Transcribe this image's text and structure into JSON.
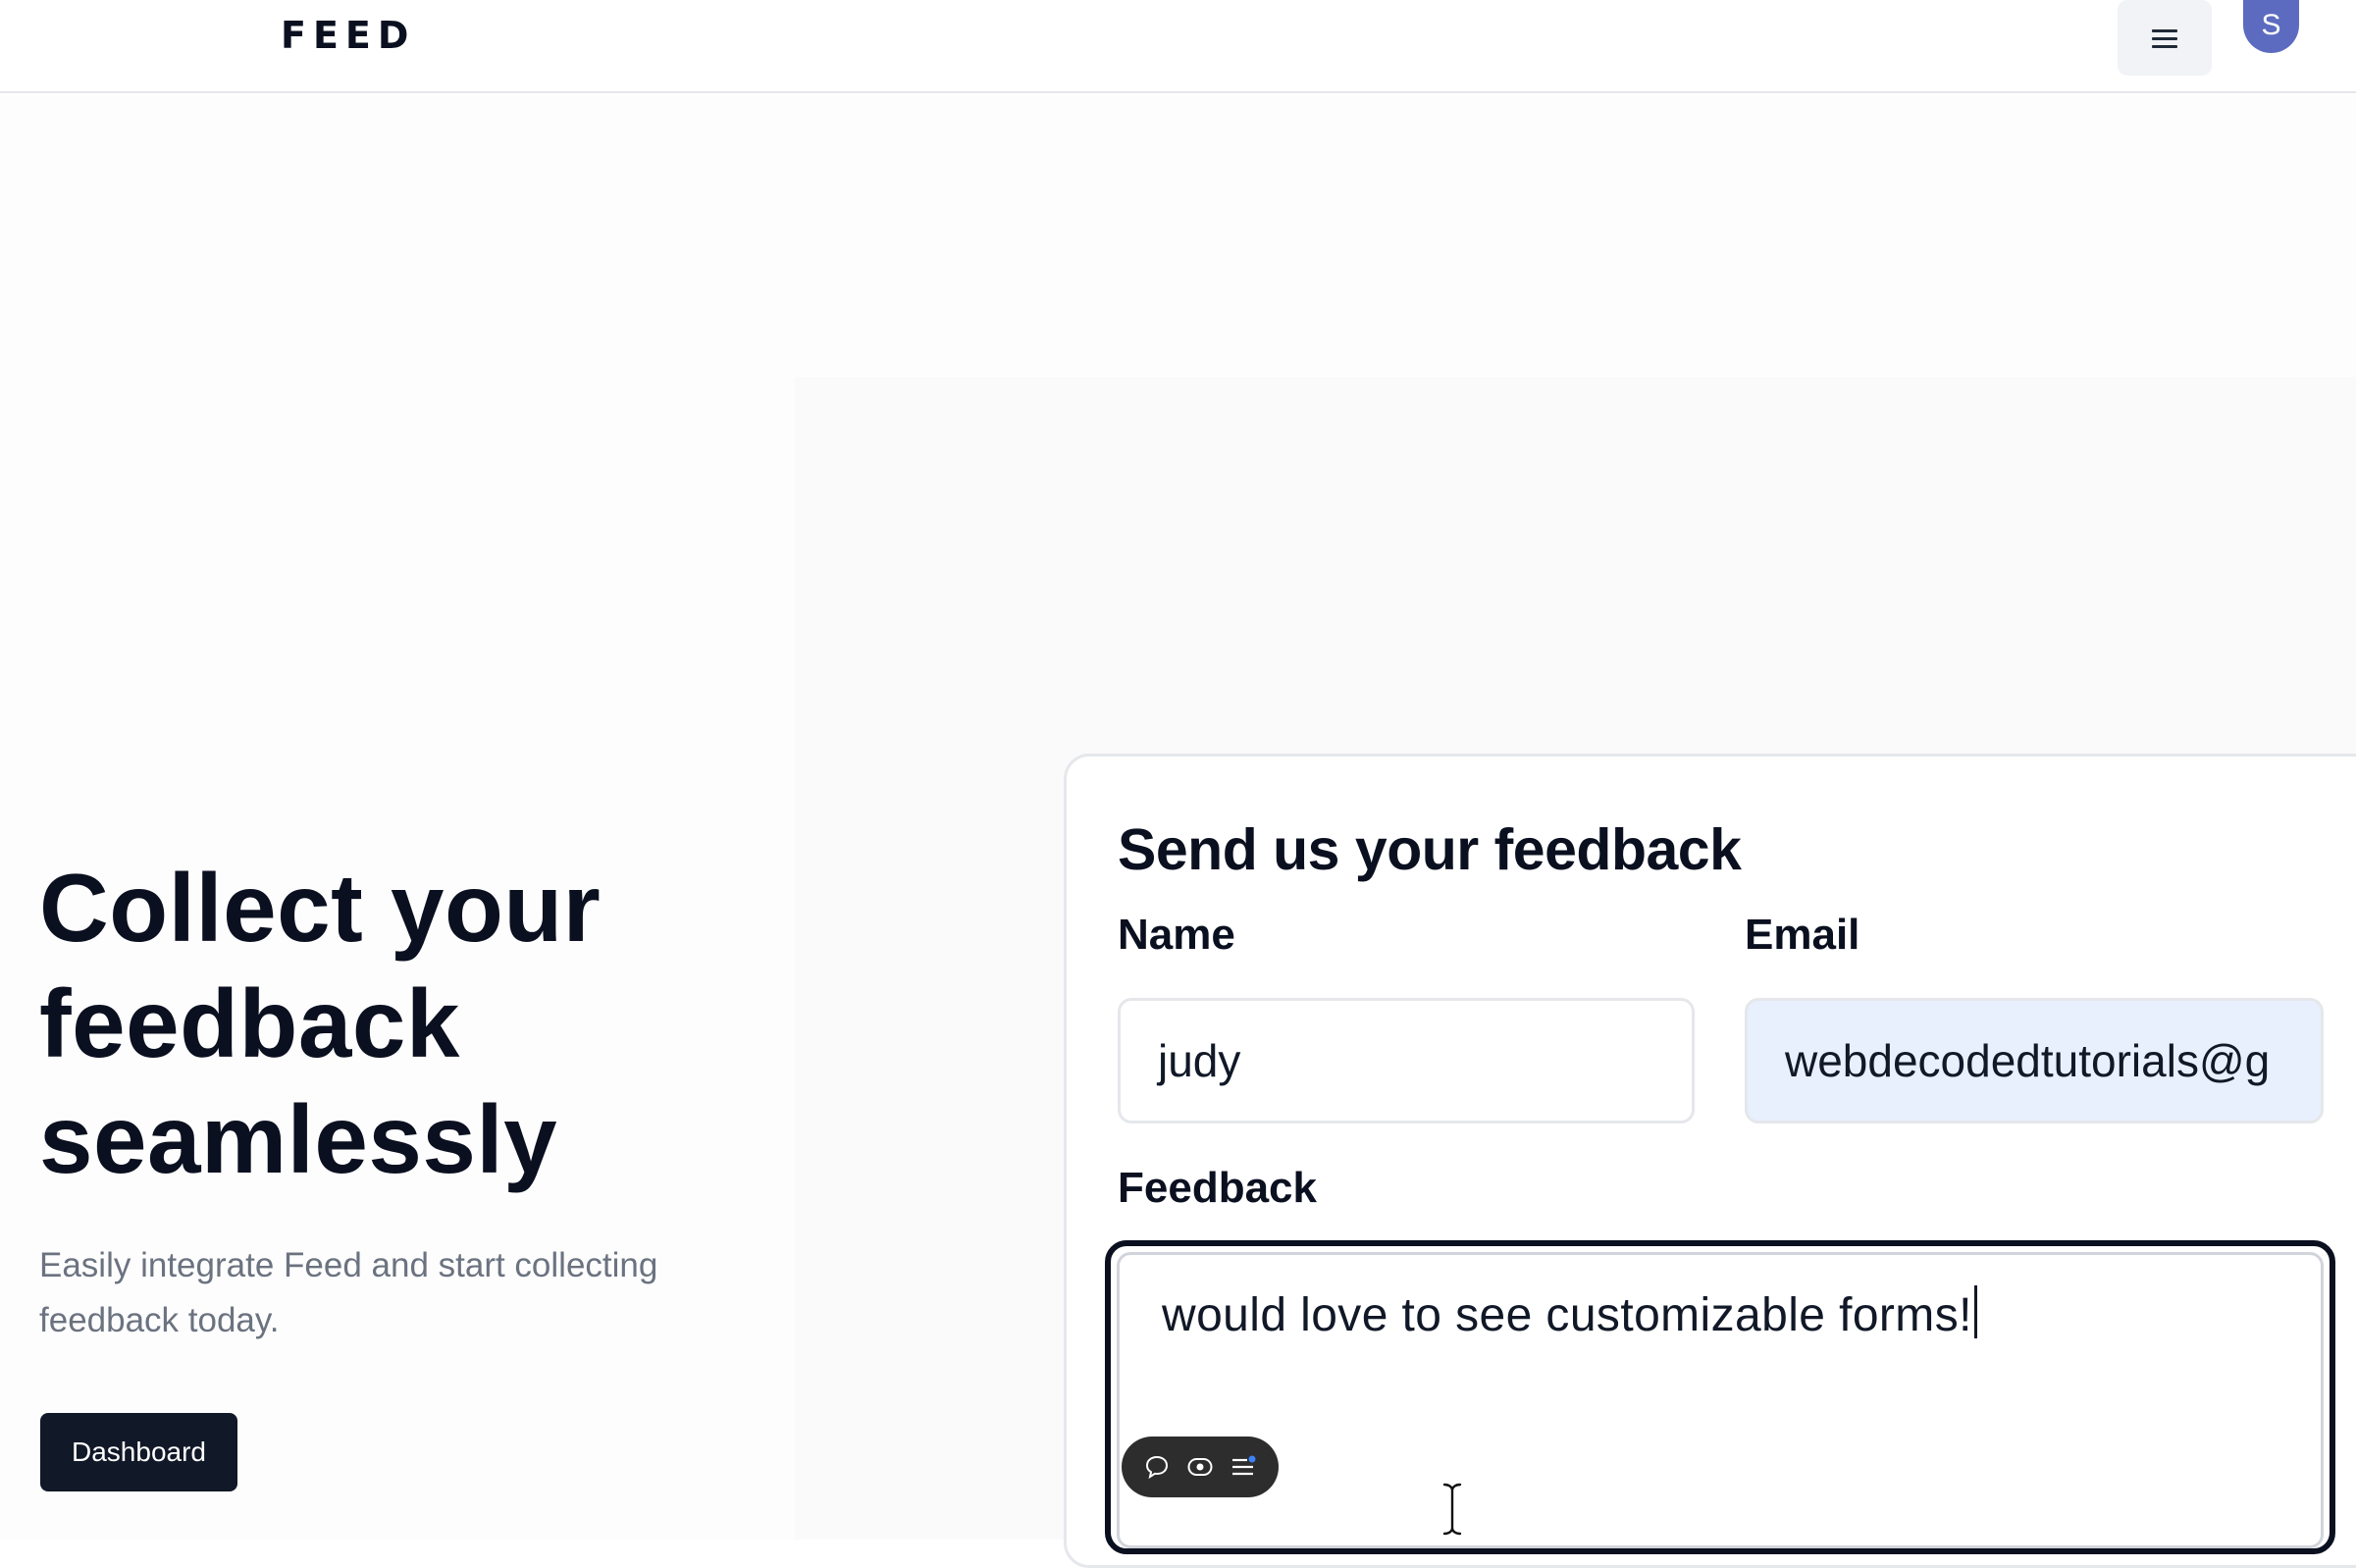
{
  "header": {
    "logo": "FEED",
    "avatar_initial": "S"
  },
  "hero": {
    "headline": "Collect your feedback seamlessly",
    "subtext": "Easily integrate Feed and start collecting feedback today.",
    "cta_label": "Dashboard"
  },
  "form": {
    "title": "Send us your feedback",
    "name_label": "Name",
    "name_value": "judy",
    "email_label": "Email",
    "email_value": "webdecodedtutorials@g",
    "feedback_label": "Feedback",
    "feedback_value": "would love to see customizable forms!"
  },
  "toolbar": {
    "icons": [
      "comment-icon",
      "eye-icon",
      "menu-notification-icon"
    ]
  },
  "colors": {
    "primary_dark": "#111827",
    "avatar": "#5c6bc0",
    "autofill_bg": "#e8f0fe",
    "muted_text": "#6b7280"
  }
}
